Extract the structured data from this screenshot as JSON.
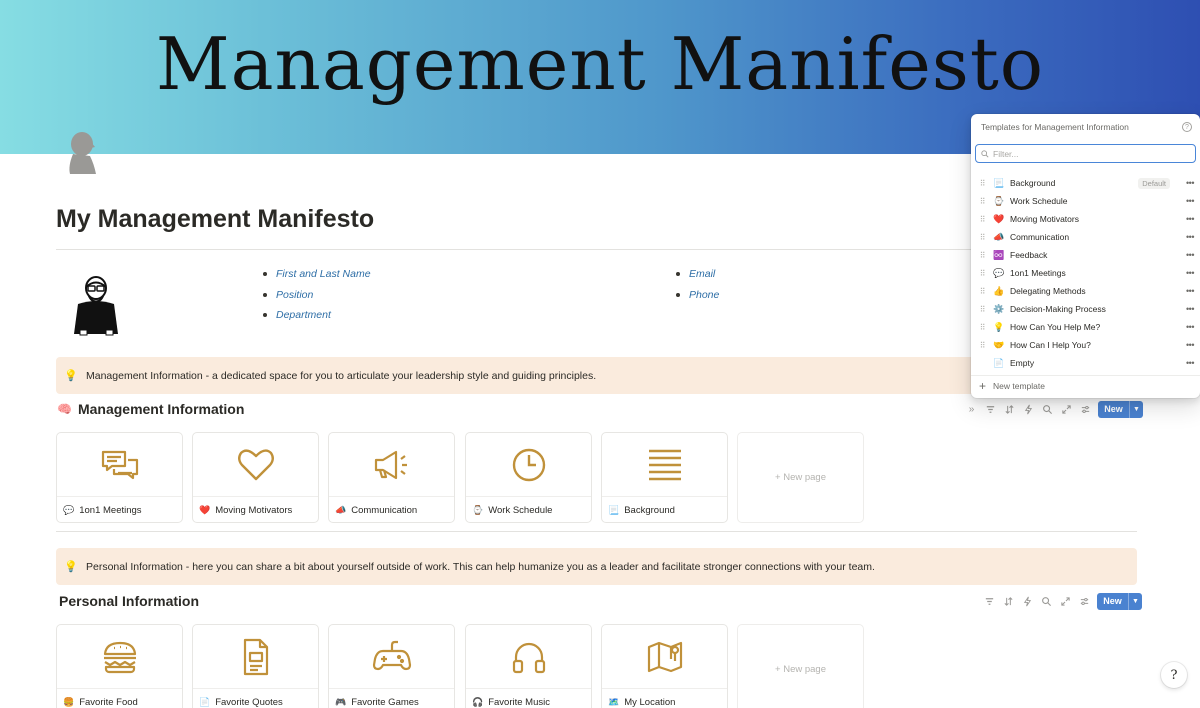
{
  "cover": {
    "title": "Management Manifesto"
  },
  "page": {
    "title": "My Management Manifesto"
  },
  "info": {
    "left": [
      "First and Last Name",
      "Position",
      "Department"
    ],
    "right": [
      "Email",
      "Phone"
    ]
  },
  "callouts": {
    "management": {
      "icon": "💡",
      "text": "Management Information - a dedicated space for you to articulate your leadership style and guiding principles."
    },
    "personal": {
      "icon": "💡",
      "text": "Personal Information - here you can share a bit about yourself outside of work. This can help humanize you as a leader and facilitate stronger connections with your team."
    }
  },
  "sections": {
    "management": {
      "icon": "🧠",
      "title": "Management Information",
      "new_label": "New",
      "cards": [
        {
          "emoji": "💬",
          "label": "1on1 Meetings",
          "art": "chat-bubbles-icon"
        },
        {
          "emoji": "❤️",
          "label": "Moving Motivators",
          "art": "heart-icon"
        },
        {
          "emoji": "📣",
          "label": "Communication",
          "art": "megaphone-icon"
        },
        {
          "emoji": "⌚",
          "label": "Work Schedule",
          "art": "clock-icon"
        },
        {
          "emoji": "📃",
          "label": "Background",
          "art": "text-lines-icon"
        }
      ],
      "new_page": "+ New page"
    },
    "personal": {
      "title": "Personal Information",
      "new_label": "New",
      "cards": [
        {
          "emoji": "🍔",
          "label": "Favorite Food",
          "art": "burger-icon"
        },
        {
          "emoji": "📄",
          "label": "Favorite Quotes",
          "art": "document-icon"
        },
        {
          "emoji": "🎮",
          "label": "Favorite Games",
          "art": "gamepad-icon"
        },
        {
          "emoji": "🎧",
          "label": "Favorite Music",
          "art": "headphones-icon"
        },
        {
          "emoji": "🗺️",
          "label": "My Location",
          "art": "map-pin-icon"
        }
      ],
      "new_page": "+ New page"
    }
  },
  "templates_menu": {
    "header": "Templates for Management Information",
    "filter_placeholder": "Filter...",
    "items": [
      {
        "emoji": "📃",
        "label": "Background",
        "badge": "Default"
      },
      {
        "emoji": "⌚",
        "label": "Work Schedule"
      },
      {
        "emoji": "❤️",
        "label": "Moving Motivators"
      },
      {
        "emoji": "📣",
        "label": "Communication"
      },
      {
        "emoji": "♾️",
        "label": "Feedback"
      },
      {
        "emoji": "💬",
        "label": "1on1 Meetings"
      },
      {
        "emoji": "👍",
        "label": "Delegating Methods"
      },
      {
        "emoji": "⚙️",
        "label": "Decision-Making Process"
      },
      {
        "emoji": "💡",
        "label": "How Can You Help Me?"
      },
      {
        "emoji": "🤝",
        "label": "How Can I Help You?"
      },
      {
        "emoji": "📄",
        "label": "Empty"
      }
    ],
    "footer": "New template"
  },
  "help": {
    "label": "?"
  },
  "colors": {
    "accent": "#4a82d0",
    "card_icon": "#c0913a",
    "callout_bg": "#faebdd",
    "link": "#2e6ea6"
  }
}
